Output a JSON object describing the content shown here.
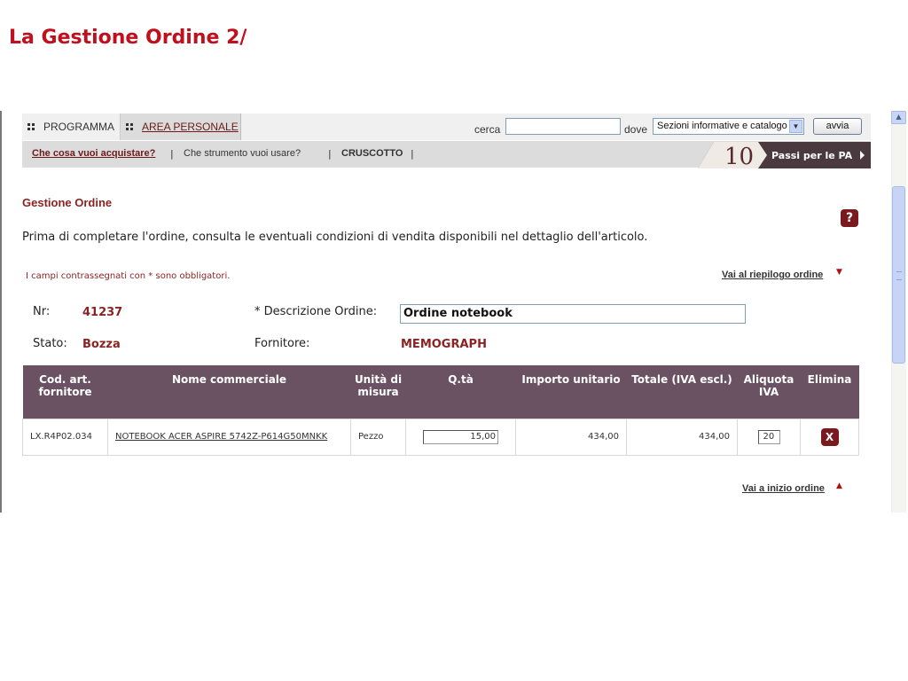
{
  "slide": {
    "title": "La Gestione Ordine 2/"
  },
  "topbar": {
    "tabs": [
      {
        "label": "PROGRAMMA"
      },
      {
        "label": "AREA PERSONALE"
      }
    ],
    "search_label": "cerca",
    "search_value": "",
    "dove_label": "dove",
    "dove_selected": "Sezioni informative e catalogo",
    "avvia_label": "avvia"
  },
  "subnav": {
    "items": [
      {
        "label": "Che cosa vuoi acquistare?"
      },
      {
        "label": "Che strumento vuoi usare?"
      },
      {
        "label": "CRUSCOTTO"
      }
    ],
    "separator": "|"
  },
  "banner": {
    "number": "10",
    "text": "Passi per le PA"
  },
  "page": {
    "heading": "Gestione Ordine",
    "help_symbol": "?",
    "intro": "Prima di completare l'ordine, consulta le eventuali condizioni di vendita disponibili nel dettaglio dell'articolo.",
    "required_note": "I campi contrassegnati con * sono obbligatori.",
    "link_riepilogo": "Vai al riepilogo ordine",
    "link_inizio": "Vai a inizio ordine"
  },
  "order": {
    "nr_label": "Nr:",
    "nr_value": "41237",
    "stato_label": "Stato:",
    "stato_value": "Bozza",
    "descrizione_label": "* Descrizione Ordine:",
    "descrizione_value": "Ordine notebook",
    "fornitore_label": "Fornitore:",
    "fornitore_value": "MEMOGRAPH"
  },
  "table": {
    "headers": [
      "Cod. art. fornitore",
      "Nome commerciale",
      "Unità di misura",
      "Q.tà",
      "Importo unitario",
      "Totale (IVA escl.)",
      "Aliquota IVA",
      "Elimina"
    ],
    "rows": [
      {
        "codice": "LX.R4P02.034",
        "nome": "NOTEBOOK ACER ASPIRE 5742Z-P614G50MNKK",
        "unita": "Pezzo",
        "quantita": "15,00",
        "importo": "434,00",
        "totale": "434,00",
        "aliquota": "20",
        "elimina": "X"
      }
    ]
  },
  "colors": {
    "brand_red": "#c0101e",
    "heading_maroon": "#8b2322",
    "table_header": "#6b5263",
    "button_maroon": "#7a1a1e"
  }
}
